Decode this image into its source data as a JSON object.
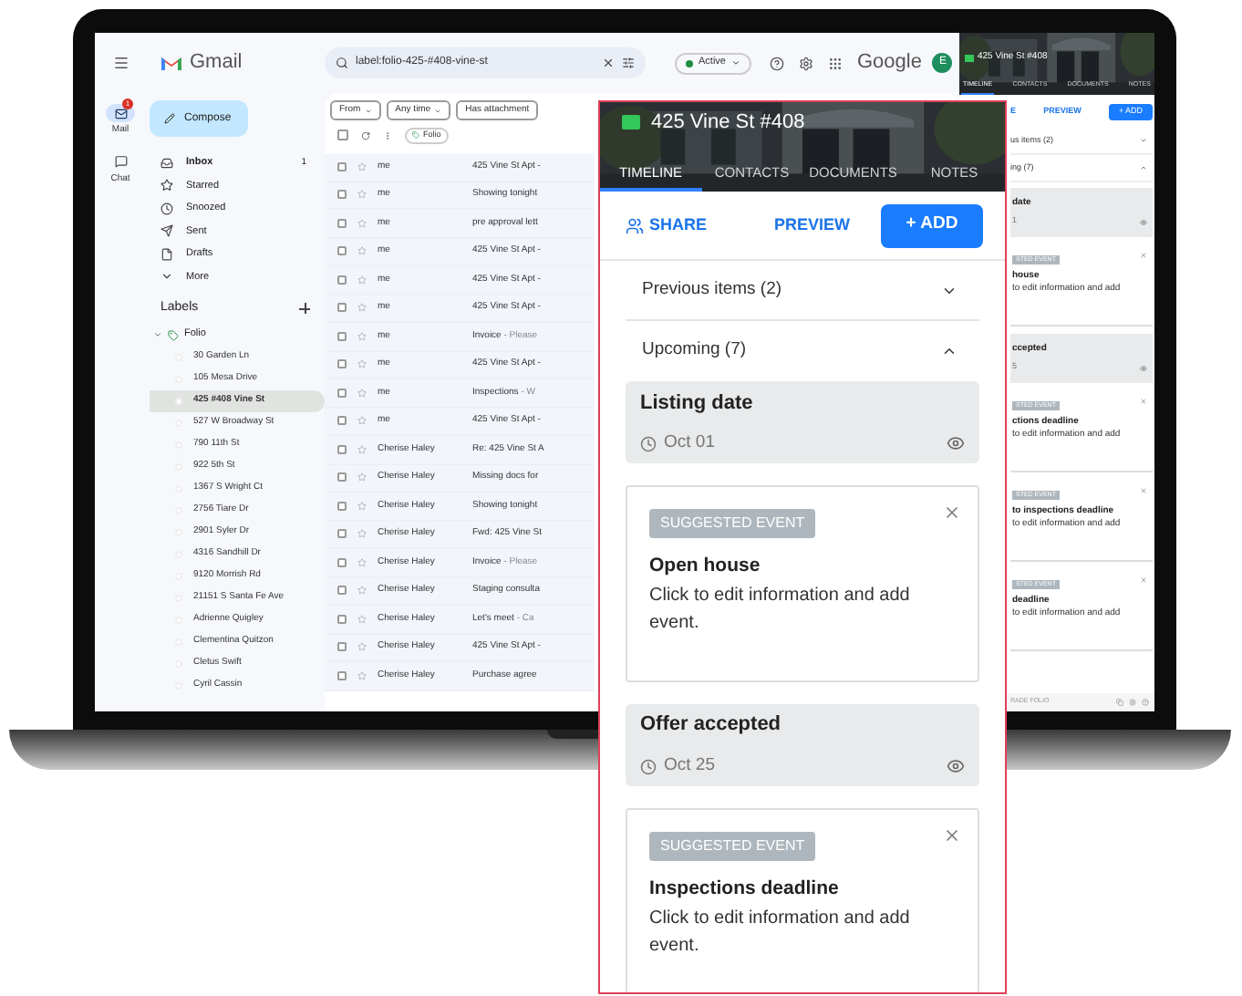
{
  "gmail": {
    "logo": "Gmail",
    "search": "label:folio-425-#408-vine-st",
    "status": "Active",
    "brand": "Google",
    "avatar": "E",
    "rail": [
      {
        "label": "Mail",
        "badge": "1",
        "selected": true
      },
      {
        "label": "Chat",
        "selected": false
      }
    ],
    "compose": "Compose",
    "nav": [
      {
        "label": "Inbox",
        "count": "1"
      },
      {
        "label": "Starred"
      },
      {
        "label": "Snoozed"
      },
      {
        "label": "Sent"
      },
      {
        "label": "Drafts"
      },
      {
        "label": "More"
      }
    ],
    "labels_title": "Labels",
    "folio": {
      "label": "Folio",
      "expanded": true,
      "children": [
        {
          "label": "30 Garden Ln",
          "selected": false
        },
        {
          "label": "105 Mesa Drive",
          "selected": false
        },
        {
          "label": "425 #408 Vine St",
          "selected": true
        },
        {
          "label": "527 W Broadway St",
          "selected": false
        },
        {
          "label": "790 11th St",
          "selected": false
        },
        {
          "label": "922 5th St",
          "selected": false
        },
        {
          "label": "1367 S Wright Ct",
          "selected": false
        },
        {
          "label": "2756 Tiare Dr",
          "selected": false
        },
        {
          "label": "2901 Syler Dr",
          "selected": false
        },
        {
          "label": "4316 Sandhill Dr",
          "selected": false
        },
        {
          "label": "9120 Morrish Rd",
          "selected": false
        },
        {
          "label": "21151 S Santa Fe Ave",
          "selected": false
        },
        {
          "label": "Adrienne Quigley",
          "selected": false
        },
        {
          "label": "Clementina Quitzon",
          "selected": false
        },
        {
          "label": "Cletus Swift",
          "selected": false
        },
        {
          "label": "Cyril Cassin",
          "selected": false
        }
      ]
    },
    "filters": [
      "From",
      "Any time",
      "Has attachment"
    ],
    "chip": "Folio",
    "select_all_checked": false,
    "emails": [
      {
        "checked": false,
        "sender": "me",
        "subject": "425 Vine St Apt -"
      },
      {
        "checked": false,
        "sender": "me",
        "subject": "Showing tonight"
      },
      {
        "checked": false,
        "sender": "me",
        "subject": "pre approval lett"
      },
      {
        "checked": false,
        "sender": "me",
        "subject": "425 Vine St Apt -"
      },
      {
        "checked": false,
        "sender": "me",
        "subject": "425 Vine St Apt -"
      },
      {
        "checked": false,
        "sender": "me",
        "subject": "425 Vine St Apt -"
      },
      {
        "checked": false,
        "sender": "me",
        "subject": "Invoice",
        "snippet": "- Please"
      },
      {
        "checked": false,
        "sender": "me",
        "subject": "425 Vine St Apt -"
      },
      {
        "checked": false,
        "sender": "me",
        "subject": "Inspections",
        "snippet": "- W"
      },
      {
        "checked": false,
        "sender": "me",
        "subject": "425 Vine St Apt -"
      },
      {
        "checked": false,
        "sender": "Cherise Haley",
        "subject": "Re: 425 Vine St A"
      },
      {
        "checked": false,
        "sender": "Cherise Haley",
        "subject": "Missing docs for"
      },
      {
        "checked": false,
        "sender": "Cherise Haley",
        "subject": "Showing tonight"
      },
      {
        "checked": false,
        "sender": "Cherise Haley",
        "subject": "Fwd: 425 Vine St"
      },
      {
        "checked": false,
        "sender": "Cherise Haley",
        "subject": "Invoice",
        "snippet": "- Please"
      },
      {
        "checked": false,
        "sender": "Cherise Haley",
        "subject": "Staging consulta"
      },
      {
        "checked": false,
        "sender": "Cherise Haley",
        "subject": "Let's meet",
        "snippet": "- Ca"
      },
      {
        "checked": false,
        "sender": "Cherise Haley",
        "subject": "425 Vine St Apt -"
      },
      {
        "checked": false,
        "sender": "Cherise Haley",
        "subject": "Purchase agree"
      }
    ]
  },
  "mini_panel": {
    "title": "425 Vine St #408",
    "tabs": [
      {
        "label": "TIMELINE",
        "selected": true
      },
      {
        "label": "CONTACTS",
        "selected": false
      },
      {
        "label": "DOCUMENTS",
        "selected": false
      },
      {
        "label": "NOTES",
        "selected": false
      }
    ],
    "share": "E",
    "preview": "PREVIEW",
    "add": "+ ADD",
    "sections": [
      {
        "label": "us items (2)",
        "expanded": false
      },
      {
        "label": "ing (7)",
        "expanded": true
      }
    ],
    "items": [
      {
        "kind": "event",
        "title": "date",
        "date": "1"
      },
      {
        "kind": "suggested",
        "badge": "STED EVENT",
        "title": "house",
        "body": "to edit information and add"
      },
      {
        "kind": "event",
        "title": "ccepted",
        "date": "5"
      },
      {
        "kind": "suggested",
        "badge": "STED EVENT",
        "title": "ctions deadline",
        "body": "to edit information and add"
      },
      {
        "kind": "suggested",
        "badge": "STED EVENT",
        "title": "to inspections deadline",
        "body": "to edit information and add"
      },
      {
        "kind": "suggested",
        "badge": "STED EVENT",
        "title": "deadline",
        "body": "to edit information and add"
      }
    ],
    "footer": "RADE FOLIO"
  },
  "panel": {
    "title": "425 Vine St #408",
    "tabs": [
      {
        "label": "TIMELINE",
        "selected": true
      },
      {
        "label": "CONTACTS",
        "selected": false
      },
      {
        "label": "DOCUMENTS",
        "selected": false
      },
      {
        "label": "NOTES",
        "selected": false
      }
    ],
    "share": "SHARE",
    "preview": "PREVIEW",
    "add": "+ ADD",
    "sections": [
      {
        "label": "Previous items (2)",
        "expanded": false
      },
      {
        "label": "Upcoming (7)",
        "expanded": true
      }
    ],
    "items": [
      {
        "kind": "event",
        "title": "Listing date",
        "date": "Oct 01"
      },
      {
        "kind": "suggested",
        "badge": "SUGGESTED EVENT",
        "title": "Open house",
        "body": "Click to edit information and add event."
      },
      {
        "kind": "event",
        "title": "Offer accepted",
        "date": "Oct 25"
      },
      {
        "kind": "suggested",
        "badge": "SUGGESTED EVENT",
        "title": "Inspections deadline",
        "body": "Click to edit information and add event."
      }
    ]
  }
}
